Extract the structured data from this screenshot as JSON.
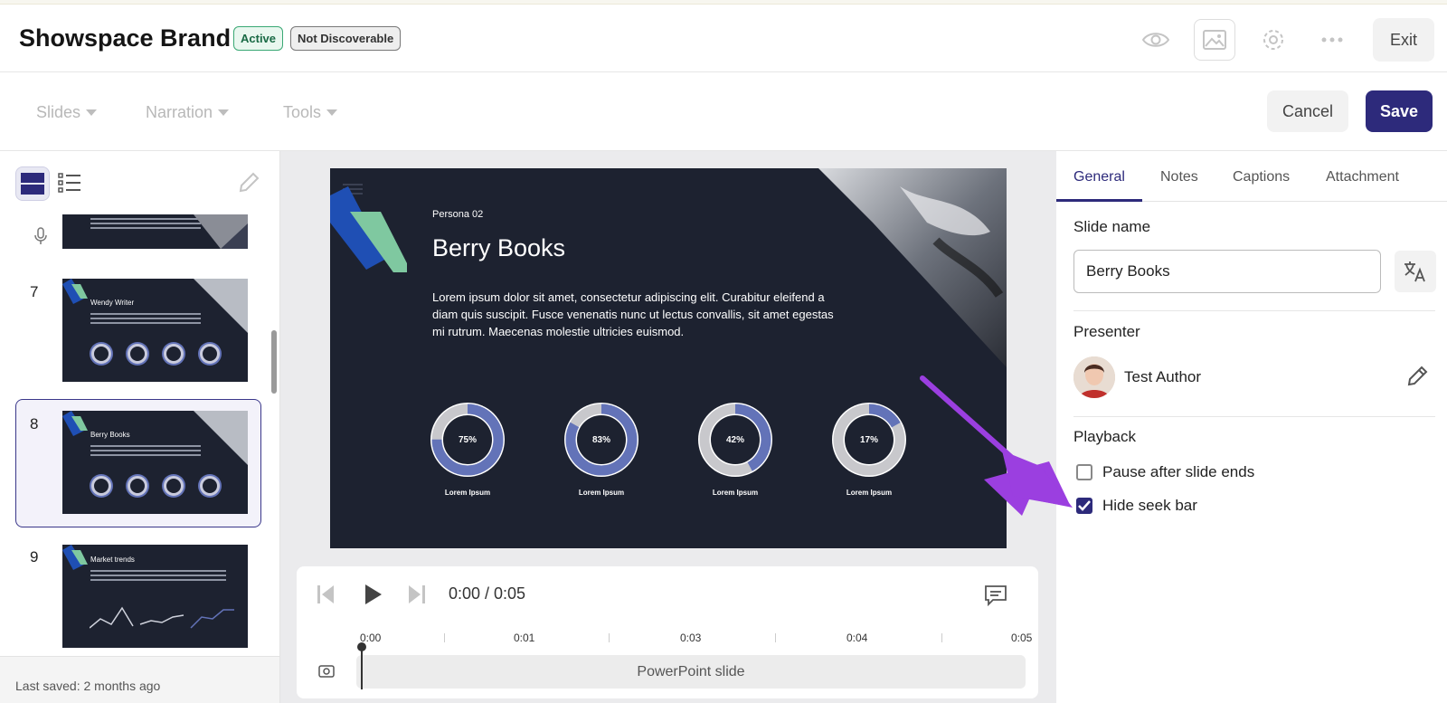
{
  "header": {
    "title": "Showspace Brand",
    "badges": {
      "active": "Active",
      "visibility": "Not Discoverable"
    },
    "icons": [
      "eye-icon",
      "image-icon",
      "gear-icon",
      "more-icon"
    ],
    "exit_label": "Exit"
  },
  "toolbar": {
    "menus": [
      {
        "label": "Slides"
      },
      {
        "label": "Narration"
      },
      {
        "label": "Tools"
      }
    ],
    "cancel_label": "Cancel",
    "save_label": "Save"
  },
  "sidebar": {
    "slides": [
      {
        "number": "7",
        "title": "Wendy Writer",
        "selected": false
      },
      {
        "number": "8",
        "title": "Berry Books",
        "selected": true
      },
      {
        "number": "9",
        "title": "Market trends",
        "selected": false
      }
    ],
    "last_saved": "Last saved: 2 months ago"
  },
  "slide": {
    "persona": "Persona 02",
    "title": "Berry Books",
    "body": "Lorem ipsum dolor sit amet, consectetur adipiscing elit. Curabitur eleifend a diam quis suscipit. Fusce venenatis nunc ut lectus convallis, sit amet egestas mi rutrum. Maecenas molestie ultricies euismod.",
    "stats": [
      {
        "value": 75,
        "text": "75%",
        "label": "Lorem Ipsum"
      },
      {
        "value": 83,
        "text": "83%",
        "label": "Lorem Ipsum"
      },
      {
        "value": 42,
        "text": "42%",
        "label": "Lorem Ipsum"
      },
      {
        "value": 17,
        "text": "17%",
        "label": "Lorem Ipsum"
      }
    ],
    "colors": {
      "background": "#1d2230",
      "accent_blue": "#1f4fb4",
      "accent_green": "#7fc8a0",
      "donut_fill": "#6373b8"
    }
  },
  "player": {
    "time": "0:00 / 0:05",
    "ticks": [
      "0:00",
      "0:01",
      "0:03",
      "0:04",
      "0:05"
    ],
    "track_label": "PowerPoint slide"
  },
  "panel": {
    "tabs": [
      {
        "label": "General"
      },
      {
        "label": "Notes"
      },
      {
        "label": "Captions"
      },
      {
        "label": "Attachment"
      }
    ],
    "slide_name_label": "Slide name",
    "slide_name_value": "Berry Books",
    "presenter_label": "Presenter",
    "presenter_name": "Test Author",
    "playback_label": "Playback",
    "options": [
      {
        "label": "Pause after slide ends",
        "checked": false
      },
      {
        "label": "Hide seek bar",
        "checked": true
      }
    ]
  },
  "colors": {
    "primary": "#2d2a7b",
    "annotation_arrow": "#9b3fe0"
  }
}
